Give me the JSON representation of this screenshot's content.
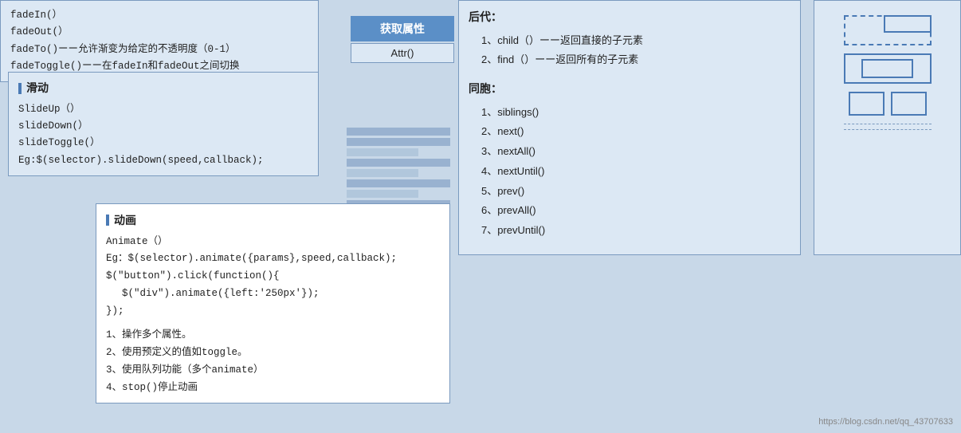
{
  "fade_section": {
    "lines": [
      "fadeIn(）",
      "fadeOut(）",
      "fadeTo()ーー允许渐变为给定的不透明度（0-1）",
      "fadeToggle()ーー在fadeIn和fadeOut之间切换"
    ]
  },
  "slide_section": {
    "title": "滑动",
    "lines": [
      "SlideUp（）",
      "slideDown(）",
      "slideToggle(）",
      "Eg:$(selector).slideDown(speed,callback);"
    ]
  },
  "get_attr": {
    "button_label": "获取属性",
    "method_label": "Attr()"
  },
  "animate_section": {
    "title": "动画",
    "lines": [
      "Animate（）",
      "Eg：$(selector).animate({params},speed,callback);",
      "$(\"button\").click(function(){",
      "  $(\"div\").animate({left:'250px'});",
      "});",
      "",
      "1、操作多个属性。",
      "2、使用预定义的值如toggle。",
      "3、使用队列功能（多个animate）",
      "4、stop()停止动画"
    ]
  },
  "descendants_section": {
    "title": "后代：",
    "items": [
      "1、child（）ーー返回直接的子元素",
      "2、find（）ーー返回所有的子元素"
    ]
  },
  "siblings_section": {
    "title": "同胞：",
    "items": [
      "1、siblings()",
      "2、next()",
      "3、nextAll()",
      "4、nextUntil()",
      "5、prev()",
      "6、prevAll()",
      "7、prevUntil()"
    ]
  },
  "watermark": {
    "text": "https://blog.csdn.net/qq_43707633"
  }
}
